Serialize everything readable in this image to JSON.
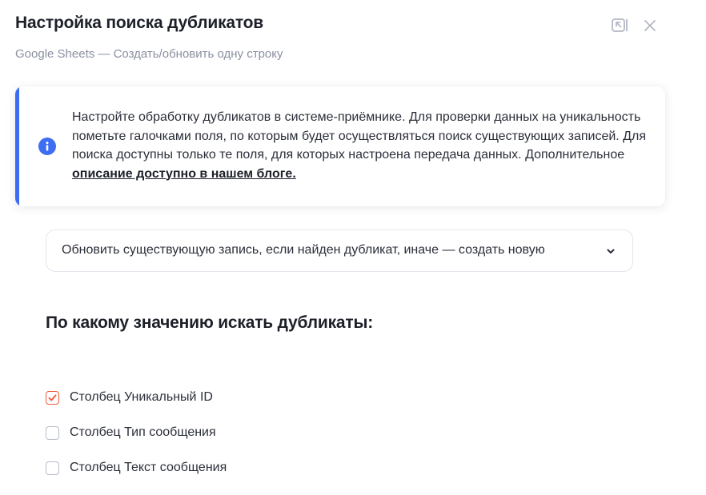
{
  "header": {
    "title": "Настройка поиска дубликатов",
    "subtitle": "Google Sheets — Создать/обновить одну строку"
  },
  "info": {
    "text": "Настройте обработку дубликатов в системе-приёмнике. Для проверки данных на уникальность пометьте галочками поля, по которым будет осуществляться поиск существующих записей. Для поиска доступны только те поля, для которых настроена передача данных. Дополнительное ",
    "link_text": "описание доступно в нашем блоге.",
    "accent_color": "#3d6df2",
    "icon": "info-icon"
  },
  "mode_select": {
    "value": "Обновить существующую запись, если найден дубликат, иначе — создать новую"
  },
  "fields_section": {
    "title": "По какому значению искать дубликаты:",
    "fields": [
      {
        "label": "Столбец Уникальный ID",
        "checked": true
      },
      {
        "label": "Столбец Тип сообщения",
        "checked": false
      },
      {
        "label": "Столбец Текст сообщения",
        "checked": false
      }
    ]
  },
  "colors": {
    "check_accent": "#ee5a3c",
    "accent": "#3d6df2"
  }
}
